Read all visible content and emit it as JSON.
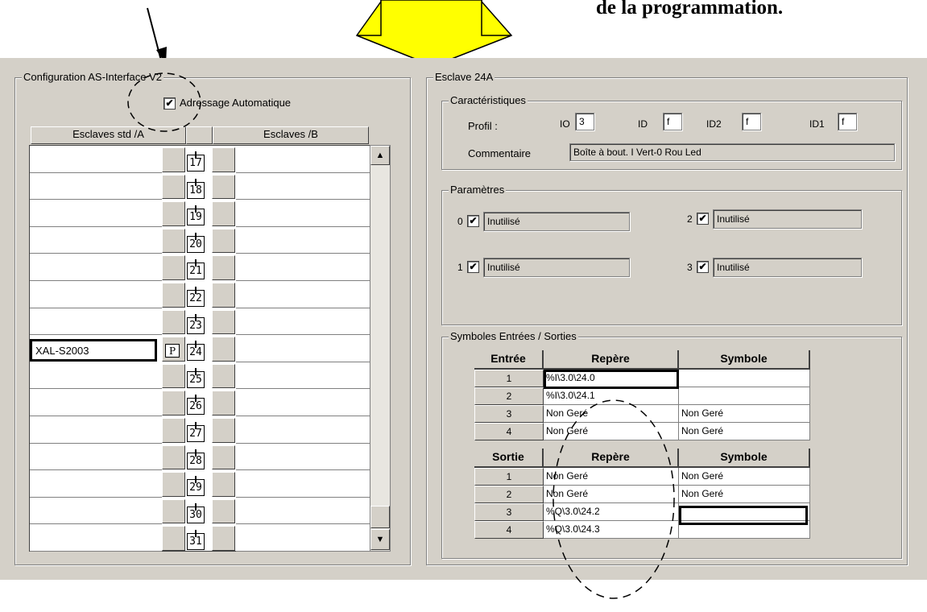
{
  "caption": "de la programmation.",
  "left_panel": {
    "legend": "Configuration AS-Interface V2",
    "auto_address_checked": true,
    "auto_address_label": "Adressage Automatique",
    "col_a_header": "Esclaves std /A",
    "col_b_header": "Esclaves /B",
    "slaves": [
      {
        "num": "17",
        "a_name": "",
        "p": ""
      },
      {
        "num": "18",
        "a_name": "",
        "p": ""
      },
      {
        "num": "19",
        "a_name": "",
        "p": ""
      },
      {
        "num": "20",
        "a_name": "",
        "p": ""
      },
      {
        "num": "21",
        "a_name": "",
        "p": ""
      },
      {
        "num": "22",
        "a_name": "",
        "p": ""
      },
      {
        "num": "23",
        "a_name": "",
        "p": ""
      },
      {
        "num": "24",
        "a_name": "XAL-S2003",
        "p": "P"
      },
      {
        "num": "25",
        "a_name": "",
        "p": ""
      },
      {
        "num": "26",
        "a_name": "",
        "p": ""
      },
      {
        "num": "27",
        "a_name": "",
        "p": ""
      },
      {
        "num": "28",
        "a_name": "",
        "p": ""
      },
      {
        "num": "29",
        "a_name": "",
        "p": ""
      },
      {
        "num": "30",
        "a_name": "",
        "p": ""
      },
      {
        "num": "31",
        "a_name": "",
        "p": ""
      }
    ],
    "scroll_up": "▲",
    "scroll_down": "▼"
  },
  "right_panel": {
    "legend": "Esclave 24A",
    "characteristics": {
      "legend": "Caractéristiques",
      "profil_label": "Profil :",
      "io_label": "IO",
      "io_value": "3",
      "id_label": "ID",
      "id_value": "f",
      "id2_label": "ID2",
      "id2_value": "f",
      "id1_label": "ID1",
      "id1_value": "f",
      "comment_label": "Commentaire",
      "comment_value": "Boîte à bout. I Vert-0 Rou Led"
    },
    "parameters": {
      "legend": "Paramètres",
      "items": [
        {
          "index": "0",
          "checked": true,
          "value": "Inutilisé"
        },
        {
          "index": "2",
          "checked": true,
          "value": "Inutilisé"
        },
        {
          "index": "1",
          "checked": true,
          "value": "Inutilisé"
        },
        {
          "index": "3",
          "checked": true,
          "value": "Inutilisé"
        }
      ]
    },
    "symbols": {
      "legend": "Symboles Entrées / Sorties",
      "inputs_header": [
        "Entrée",
        "Repère",
        "Symbole"
      ],
      "inputs": [
        {
          "n": "1",
          "repere": "%I\\3.0\\24.0",
          "symbole": ""
        },
        {
          "n": "2",
          "repere": "%I\\3.0\\24.1",
          "symbole": ""
        },
        {
          "n": "3",
          "repere": "Non Geré",
          "symbole": "Non Geré"
        },
        {
          "n": "4",
          "repere": "Non Geré",
          "symbole": "Non Geré"
        }
      ],
      "outputs_header": [
        "Sortie",
        "Repère",
        "Symbole"
      ],
      "outputs": [
        {
          "n": "1",
          "repere": "Non Geré",
          "symbole": "Non Geré"
        },
        {
          "n": "2",
          "repere": "Non Geré",
          "symbole": "Non Geré"
        },
        {
          "n": "3",
          "repere": "%Q\\3.0\\24.2",
          "symbole": ""
        },
        {
          "n": "4",
          "repere": "%Q\\3.0\\24.3",
          "symbole": ""
        }
      ]
    }
  },
  "colors": {
    "panel": "#d4d0c8",
    "arrow": "#ffff00"
  }
}
